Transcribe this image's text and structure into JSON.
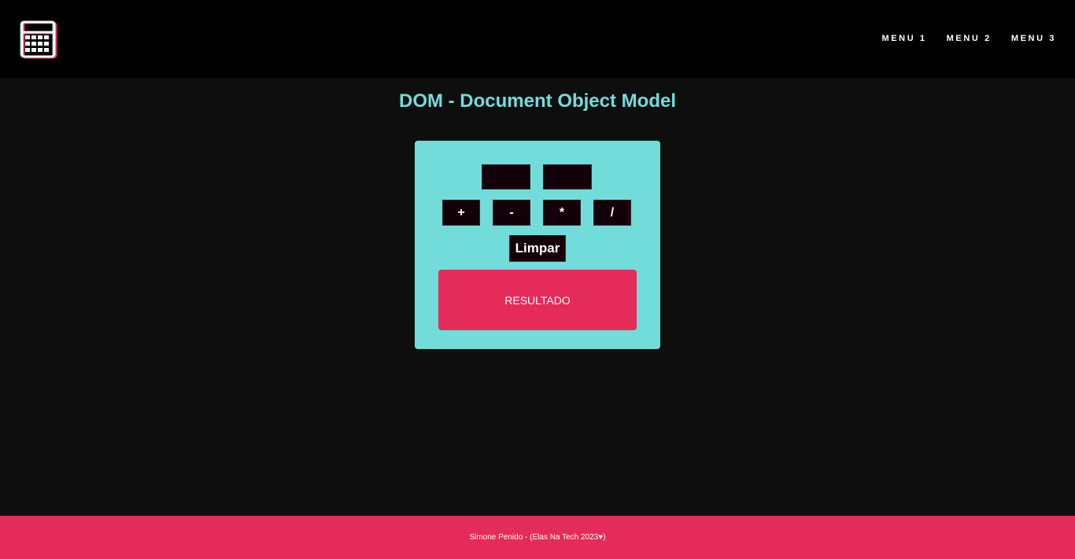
{
  "header": {
    "logo_icon": "calculator-icon",
    "nav": [
      {
        "label": "MENU 1"
      },
      {
        "label": "MENU 2"
      },
      {
        "label": "MENU 3"
      }
    ]
  },
  "main": {
    "title": "DOM - Document Object Model"
  },
  "calculator": {
    "input1": {
      "value": "",
      "placeholder": ""
    },
    "input2": {
      "value": "",
      "placeholder": ""
    },
    "operators": [
      {
        "label": "+"
      },
      {
        "label": "-"
      },
      {
        "label": "*"
      },
      {
        "label": "/"
      }
    ],
    "clear_label": "Limpar",
    "result_label": "RESULTADO"
  },
  "footer": {
    "text": "Simone Penido - (Elas Na Tech 2023♥)"
  },
  "colors": {
    "header_bg": "#000000",
    "page_bg": "#0e0e0e",
    "accent_teal": "#72dcdb",
    "accent_pink": "#e52b59",
    "control_bg": "#140008"
  }
}
